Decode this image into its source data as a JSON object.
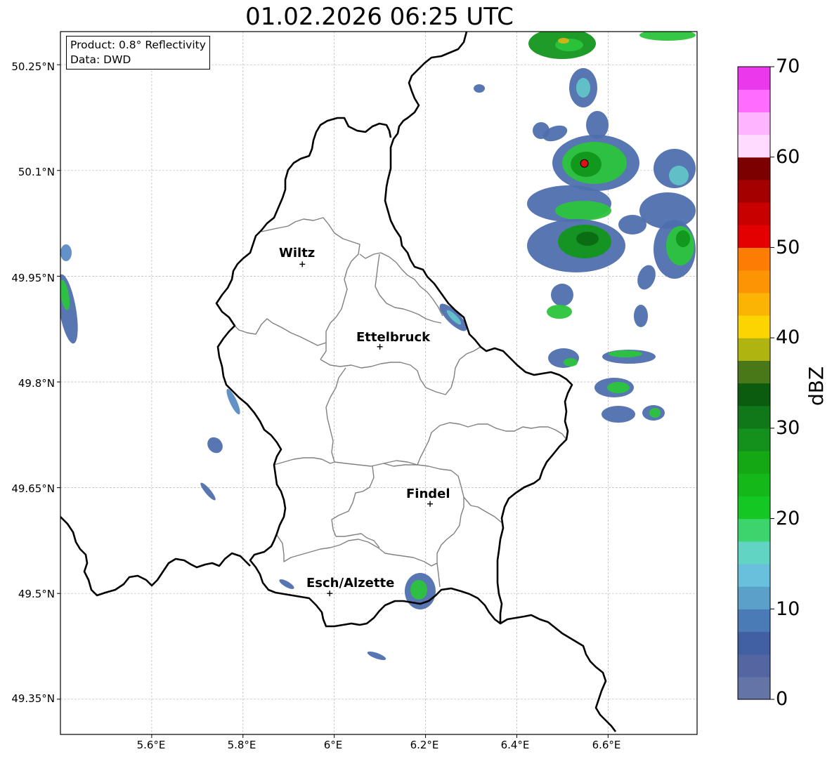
{
  "title": "01.02.2026 06:25 UTC",
  "info": {
    "product": "Product: 0.8° Reflectivity",
    "data": "Data: DWD"
  },
  "lat_labels": [
    "50.25°N",
    "50.1°N",
    "49.95°N",
    "49.8°N",
    "49.65°N",
    "49.5°N",
    "49.35°N"
  ],
  "lon_labels": [
    "5.6°E",
    "5.8°E",
    "6°E",
    "6.2°E",
    "6.4°E",
    "6.6°E"
  ],
  "places": [
    {
      "name": "Wiltz",
      "lon": 5.93,
      "lat": 49.967
    },
    {
      "name": "Ettelbruck",
      "lon": 6.1,
      "lat": 49.85
    },
    {
      "name": "Findel",
      "lon": 6.21,
      "lat": 49.627
    },
    {
      "name": "Esch/Alzette",
      "lon": 5.99,
      "lat": 49.5
    }
  ],
  "radar_site": {
    "lon": 6.548,
    "lat": 50.11
  },
  "colorbar": {
    "label": "dBZ",
    "ticks": [
      "0",
      "10",
      "20",
      "30",
      "40",
      "50",
      "60",
      "70"
    ],
    "colors": [
      "#6474a6",
      "#5366a1",
      "#4160a3",
      "#4a7bb6",
      "#5aa0c8",
      "#68c0dd",
      "#62d4c4",
      "#3cd46c",
      "#14c824",
      "#14b818",
      "#14a814",
      "#14901c",
      "#107818",
      "#0c5c10",
      "#487818",
      "#b0b410",
      "#fcd400",
      "#fcb404",
      "#fc9404",
      "#fc7c04",
      "#e40000",
      "#c80000",
      "#a40000",
      "#7c0000",
      "#ffdcff",
      "#ffb4ff",
      "#ff6cff",
      "#ec38ec"
    ]
  },
  "colors": {
    "border": "#000000",
    "canton": "#808080",
    "grid": "#b8b8b8",
    "radar_dot": "#e01010"
  }
}
